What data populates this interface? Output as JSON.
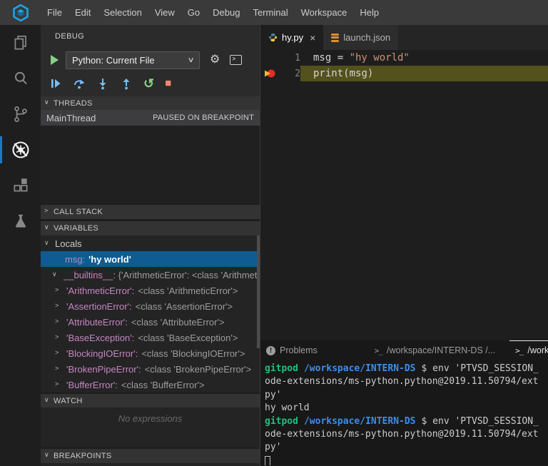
{
  "colors": {
    "selection_blue": "#0e5c91",
    "var_purple": "#c586c0",
    "string_orange": "#ce9178",
    "line_highlight": "#53511c",
    "breakpoint_red": "#e32d22",
    "breakpoint_arrow_yellow": "#f5b73d",
    "prompt_green": "#23be7d",
    "prompt_blue": "#3b8eea",
    "debug_blue": "#75beff",
    "debug_green": "#89d185",
    "debug_stop_red": "#f48771",
    "active_indicator_blue": "#1a78c8",
    "logo_blue": "#1aa6e4"
  },
  "icons": {
    "chevron_down": "∨",
    "chevron_right": ">",
    "gear": "⚙",
    "restart": "↺",
    "stop": "■",
    "close": "×",
    "problems": "!",
    "terminal": ">_",
    "console_caret": ">"
  },
  "menubar": {
    "items": [
      "File",
      "Edit",
      "Selection",
      "View",
      "Go",
      "Debug",
      "Terminal",
      "Workspace",
      "Help"
    ]
  },
  "activity_bar": {
    "items": [
      {
        "name": "explorer"
      },
      {
        "name": "search"
      },
      {
        "name": "source-control"
      },
      {
        "name": "debug",
        "active": true
      },
      {
        "name": "extensions"
      },
      {
        "name": "tests"
      }
    ]
  },
  "debug_sidebar": {
    "title": "DEBUG",
    "config": "Python: Current File",
    "threads": {
      "header": "THREADS",
      "thread_name": "MainThread",
      "status": "PAUSED ON BREAKPOINT"
    },
    "call_stack": {
      "header": "CALL STACK"
    },
    "variables": {
      "header": "VARIABLES",
      "scope_label": "Locals",
      "selected_var": {
        "name": "msg:",
        "value": "'hy world'"
      },
      "builtins": {
        "name": "__builtins__",
        "value": ": {'ArithmeticError': <class 'Arithmeti.."
      },
      "items": [
        {
          "name": "'ArithmeticError':",
          "value": "<class 'ArithmeticError'>"
        },
        {
          "name": "'AssertionError':",
          "value": "<class 'AssertionError'>"
        },
        {
          "name": "'AttributeError':",
          "value": "<class 'AttributeError'>"
        },
        {
          "name": "'BaseException':",
          "value": "<class 'BaseException'>"
        },
        {
          "name": "'BlockingIOError':",
          "value": "<class 'BlockingIOError'>"
        },
        {
          "name": "'BrokenPipeError':",
          "value": "<class 'BrokenPipeError'>"
        },
        {
          "name": "'BufferError':",
          "value": "<class 'BufferError'>"
        }
      ]
    },
    "watch": {
      "header": "WATCH",
      "empty_message": "No expressions"
    },
    "breakpoints": {
      "header": "BREAKPOINTS"
    }
  },
  "editor": {
    "tabs": [
      {
        "label": "hy.py"
      },
      {
        "label": "launch.json"
      }
    ],
    "lines": [
      {
        "num": "1",
        "code_plain": "msg = ",
        "code_string": "\"hy world\""
      },
      {
        "num": "2",
        "code": "print(msg)"
      }
    ]
  },
  "panel": {
    "tabs": [
      {
        "label": "Problems"
      },
      {
        "label": "/workspace/INTERN-DS /..."
      },
      {
        "label": "/workspa"
      }
    ]
  },
  "terminal": {
    "prompt_user": "gitpod",
    "prompt_path": "/workspace/INTERN-DS",
    "prompt_cmd": "$ env 'PTVSD_SESSION_",
    "wrap_line": "ode-extensions/ms-python.python@2019.11.50794/ext",
    "wrap_line2": "py'",
    "output": "hy world"
  }
}
